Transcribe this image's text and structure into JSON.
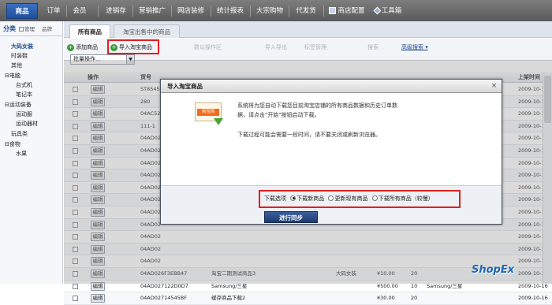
{
  "topnav": {
    "tabs": [
      "商品",
      "订单",
      "会员",
      "进销存",
      "营销推广",
      "网店装修",
      "统计报表",
      "大宗购物",
      "代发货"
    ],
    "right_items": [
      "商店配置",
      "工具箱"
    ]
  },
  "sidebar": {
    "tabs": [
      "分类",
      "管理",
      "品牌"
    ],
    "items": [
      {
        "label": "大码女装",
        "style": "blue"
      },
      {
        "label": "时装鞋",
        "style": "normal"
      },
      {
        "label": "其他",
        "style": "normal"
      },
      {
        "label": "⊟电脑",
        "style": "normal"
      },
      {
        "label": "台式机",
        "style": "normal"
      },
      {
        "label": "笔记本",
        "style": "normal"
      },
      {
        "label": "⊟运动装备",
        "style": "normal"
      },
      {
        "label": "运动服",
        "style": "normal"
      },
      {
        "label": "运动器材",
        "style": "normal"
      },
      {
        "label": "玩具类",
        "style": "normal"
      },
      {
        "label": "⊟食物",
        "style": "normal"
      },
      {
        "label": "水果",
        "style": "normal"
      }
    ]
  },
  "main": {
    "tabs": [
      "所有商品",
      "淘宝出售中的商品"
    ],
    "toolbar": {
      "add_goods": "添加商品",
      "import_taobao": "导入淘宝商品",
      "batch_select": "批量操作...",
      "groups": [
        "数以操作区",
        "导入导出",
        "标签管理",
        "搜索"
      ],
      "advanced_search": "高级搜索"
    },
    "table": {
      "headers": [
        "操作",
        "货号",
        "上架时间"
      ],
      "edit_label": "编辑",
      "rows": [
        {
          "sku": "ST8545",
          "name": "",
          "category": "",
          "price": "",
          "stock": "",
          "brand": "",
          "date": "2009-10-10"
        },
        {
          "sku": "280",
          "name": "",
          "category": "",
          "price": "",
          "stock": "",
          "brand": "",
          "date": "2009-10-10"
        },
        {
          "sku": "04AC52",
          "name": "",
          "category": "",
          "price": "",
          "stock": "",
          "brand": "",
          "date": "2009-10-10"
        },
        {
          "sku": "111-1",
          "name": "",
          "category": "",
          "price": "",
          "stock": "",
          "brand": "",
          "date": "2009-10-12"
        },
        {
          "sku": "04AD02",
          "name": "",
          "category": "",
          "price": "",
          "stock": "",
          "brand": "",
          "date": "2009-10-14"
        },
        {
          "sku": "04AD02",
          "name": "",
          "category": "",
          "price": "",
          "stock": "",
          "brand": "",
          "date": "2009-10-14"
        },
        {
          "sku": "04AD02",
          "name": "",
          "category": "",
          "price": "",
          "stock": "",
          "brand": "",
          "date": "2009-10-14"
        },
        {
          "sku": "04AD02",
          "name": "",
          "category": "",
          "price": "",
          "stock": "",
          "brand": "",
          "date": "2009-10-14"
        },
        {
          "sku": "04AD02",
          "name": "",
          "category": "",
          "price": "",
          "stock": "",
          "brand": "",
          "date": "2009-10-15"
        },
        {
          "sku": "04AD02",
          "name": "",
          "category": "",
          "price": "",
          "stock": "",
          "brand": "",
          "date": "2009-10-15"
        },
        {
          "sku": "04AD02",
          "name": "",
          "category": "",
          "price": "",
          "stock": "",
          "brand": "",
          "date": "2009-10-16"
        },
        {
          "sku": "04AD02",
          "name": "",
          "category": "",
          "price": "",
          "stock": "",
          "brand": "",
          "date": "2009-10-16"
        },
        {
          "sku": "04AD02",
          "name": "",
          "category": "",
          "price": "",
          "stock": "",
          "brand": "",
          "date": "2009-10-16"
        },
        {
          "sku": "04AD02",
          "name": "",
          "category": "",
          "price": "",
          "stock": "",
          "brand": "",
          "date": "2009-10-16"
        },
        {
          "sku": "04AD02",
          "name": "",
          "category": "",
          "price": "",
          "stock": "",
          "brand": "",
          "date": "2009-10-16"
        },
        {
          "sku": "04AD026F3EBB47",
          "name": "淘宝二期测试商品3",
          "category": "大码女装",
          "price": "¥10.00",
          "stock": "20",
          "brand": "",
          "date": "2009-10-16"
        },
        {
          "sku": "04AD027122D0D7",
          "name": "Samsung/三星",
          "category": "",
          "price": "¥500.00",
          "stock": "10",
          "brand": "Samsung/三星",
          "date": "2009-10-16"
        },
        {
          "sku": "04AD02714545BF",
          "name": "缓存商品下载2",
          "category": "",
          "price": "¥30.00",
          "stock": "20",
          "brand": "",
          "date": "2009-10-16"
        }
      ]
    }
  },
  "dialog": {
    "title": "导入淘宝商品",
    "close": "×",
    "logo_text": "淘宝网",
    "message1": "系统将为您自动下载您目前淘宝店铺的所有商品数据和历史订单数据，请点击\"开始\"按钮启动下载。",
    "message2": "下载过程可能会需要一段时间，请不要关闭或刷新浏览器。",
    "options_label": "下载选项",
    "options": [
      "下载新商品",
      "更新现有商品",
      "下载所有商品（较慢）"
    ],
    "selected_option": 0,
    "sync_button": "进行同步"
  },
  "watermark": "ShopEx"
}
